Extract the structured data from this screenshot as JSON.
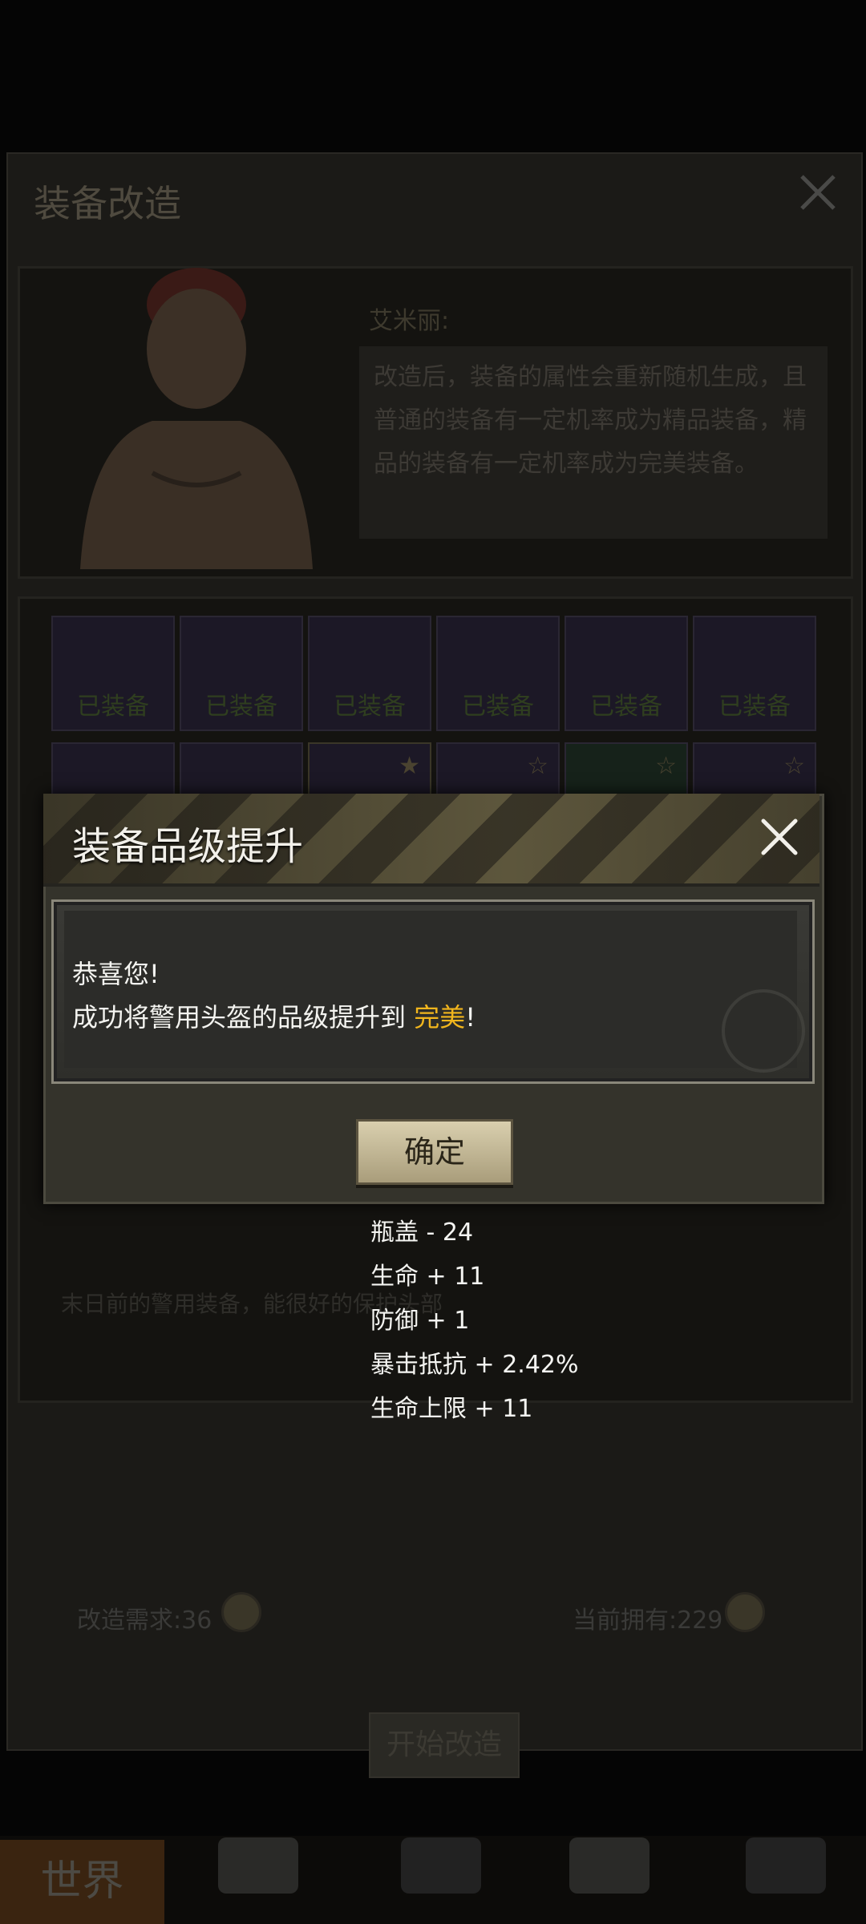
{
  "background": {
    "panel_title": "装备改造",
    "npc_name": "艾米丽:",
    "npc_text_lines": [
      "改造后，装备的属性会重新随机生成，且",
      "普通的装备有一定机率成为精品装备，精",
      "品的装备有一定机率成为完美装备。"
    ],
    "equipped_label": "已装备",
    "item_description": "末日前的警用装备，能很好的保护头部",
    "requirement_label": "改造需求:36",
    "owned_label": "当前拥有:229",
    "start_button": "开始改造",
    "nav_world": "世界"
  },
  "modal": {
    "title": "装备品级提升",
    "line1": "恭喜您!",
    "line2_prefix": "成功将警用头盔的品级提升到 ",
    "line2_highlight": "完美",
    "line2_suffix": "!",
    "confirm_button": "确定"
  },
  "stats": [
    "瓶盖 - 24",
    "生命 + 11",
    "防御 + 1",
    "暴击抵抗 + 2.42%",
    "生命上限 + 11"
  ],
  "colors": {
    "highlight": "#f2b61d",
    "modal_bg": "#34332b",
    "button_bg": "#d9cfae"
  },
  "icons": [
    "close-icon",
    "coin-icon",
    "star-icon",
    "hazard-icon"
  ]
}
